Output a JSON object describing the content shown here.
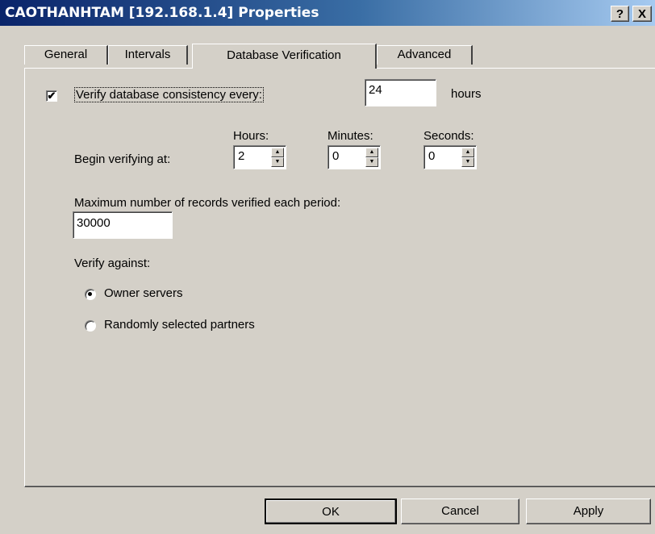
{
  "window": {
    "title": "CAOTHANHTAM [192.168.1.4] Properties",
    "help_label": "?",
    "close_label": "X"
  },
  "tabs": [
    "General",
    "Intervals",
    "Database Verification",
    "Advanced"
  ],
  "active_tab": "Database Verification",
  "verify": {
    "checkbox_label": "Verify database consistency every:",
    "checked": true,
    "check_mark": "✔",
    "hours_value": "24",
    "hours_unit": "hours"
  },
  "begin": {
    "label": "Begin verifying at:",
    "hours_label": "Hours:",
    "minutes_label": "Minutes:",
    "seconds_label": "Seconds:",
    "hours_value": "2",
    "minutes_value": "0",
    "seconds_value": "0",
    "up_arrow": "▲",
    "down_arrow": "▼"
  },
  "max_records": {
    "label": "Maximum number of records verified each period:",
    "value": "30000"
  },
  "verify_against": {
    "label": "Verify against:",
    "options": [
      "Owner servers",
      "Randomly selected partners"
    ],
    "selected": "Owner servers"
  },
  "buttons": {
    "ok": "OK",
    "cancel": "Cancel",
    "apply": "Apply"
  }
}
